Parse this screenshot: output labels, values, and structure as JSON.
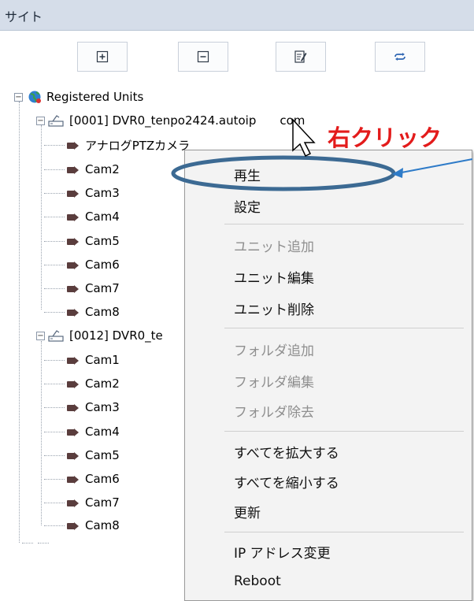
{
  "header": {
    "title": "サイト"
  },
  "toolbar": {
    "buttons": [
      {
        "icon": "plus-icon"
      },
      {
        "icon": "minus-icon"
      },
      {
        "icon": "edit-icon"
      },
      {
        "icon": "refresh-icon"
      }
    ]
  },
  "tree": {
    "root": "Registered Units",
    "unit1": {
      "label": "[0001] DVR0_tenpo2424.autoip",
      "label_suffix": "com",
      "cameras": [
        "アナログPTZカメラ",
        "Cam2",
        "Cam3",
        "Cam4",
        "Cam5",
        "Cam6",
        "Cam7",
        "Cam8"
      ]
    },
    "unit2": {
      "label": "[0012] DVR0_te",
      "cameras": [
        "Cam1",
        "Cam2",
        "Cam3",
        "Cam4",
        "Cam5",
        "Cam6",
        "Cam7",
        "Cam8"
      ]
    }
  },
  "context_menu": {
    "play": "再生",
    "settings": "設定",
    "add_unit": "ユニット追加",
    "edit_unit": "ユニット編集",
    "delete_unit": "ユニット削除",
    "add_folder": "フォルダ追加",
    "edit_folder": "フォルダ編集",
    "remove_folder": "フォルダ除去",
    "expand_all": "すべてを拡大する",
    "collapse_all": "すべてを縮小する",
    "refresh": "更新",
    "change_ip": "IP アドレス変更",
    "reboot": "Reboot"
  },
  "annotation": {
    "text": "右クリック",
    "color": "#e31b1b",
    "arrow_color": "#2e7bc8",
    "ellipse_color": "#3c6a93"
  }
}
